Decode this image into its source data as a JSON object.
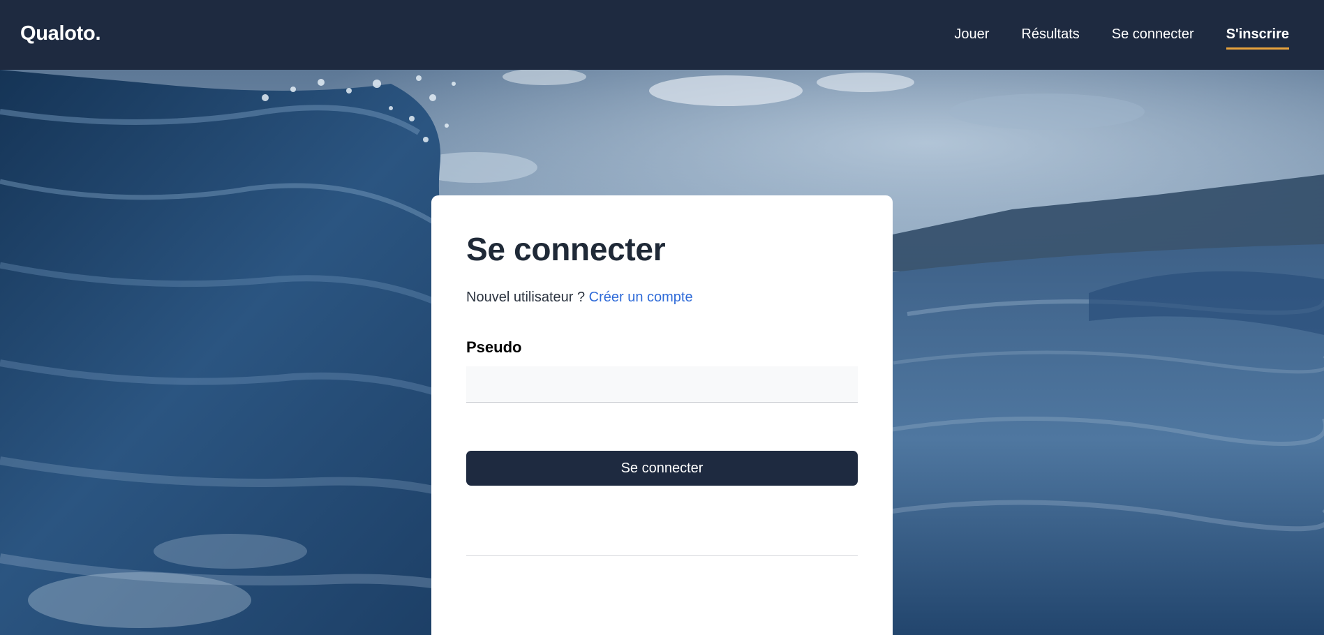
{
  "header": {
    "brand": "Qualoto.",
    "nav": [
      {
        "label": "Jouer"
      },
      {
        "label": "Résultats"
      },
      {
        "label": "Se connecter"
      },
      {
        "label": "S'inscrire",
        "active": true
      }
    ]
  },
  "login": {
    "title": "Se connecter",
    "new_user_text": "Nouvel utilisateur ?",
    "create_account_link": "Créer un compte",
    "pseudo_label": "Pseudo",
    "pseudo_value": "",
    "submit_label": "Se connecter"
  },
  "colors": {
    "navbar_bg": "#1e2a40",
    "active_underline": "#e8a33d",
    "link": "#2f6bd8",
    "button_bg": "#1e2a40"
  }
}
